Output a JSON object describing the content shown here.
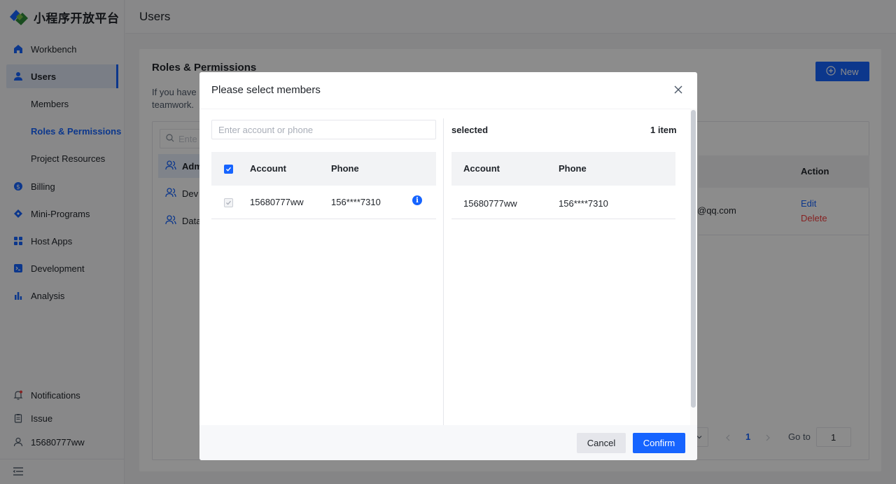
{
  "app": {
    "logo_text": "小程序开放平台",
    "page_title": "Users"
  },
  "sidebar": {
    "items": [
      {
        "label": "Workbench",
        "icon": "home-icon"
      },
      {
        "label": "Users",
        "icon": "user-icon"
      },
      {
        "label": "Billing",
        "icon": "coin-icon"
      },
      {
        "label": "Mini-Programs",
        "icon": "diamond-icon"
      },
      {
        "label": "Host Apps",
        "icon": "grid-icon"
      },
      {
        "label": "Development",
        "icon": "terminal-icon"
      },
      {
        "label": "Analysis",
        "icon": "bar-chart-icon"
      }
    ],
    "sub_items": [
      "Members",
      "Roles & Permissions",
      "Project Resources"
    ],
    "bottom": [
      {
        "label": "Notifications",
        "icon": "bell-icon"
      },
      {
        "label": "Issue",
        "icon": "clipboard-icon"
      },
      {
        "label": "15680777ww",
        "icon": "account-icon"
      }
    ]
  },
  "main": {
    "section_title": "Roles & Permissions",
    "desc_line1": "If you have",
    "desc_line2": "teamwork.",
    "new_button": "New",
    "role_search_placeholder": "Ente",
    "roles": [
      "Adm",
      "Dev",
      "Data"
    ],
    "action_header": "Action",
    "row_email": "@qq.com",
    "edit_link": "Edit",
    "delete_link": "Delete",
    "pagination": {
      "current_page": "1",
      "goto_label": "Go to",
      "goto_value": "1"
    }
  },
  "modal": {
    "title": "Please select members",
    "search_placeholder": "Enter account or phone",
    "left_table": {
      "headers": {
        "account": "Account",
        "phone": "Phone"
      },
      "rows": [
        {
          "account": "15680777ww",
          "phone": "156****7310"
        }
      ]
    },
    "selected_label": "selected",
    "selected_count": "1 item",
    "right_table": {
      "headers": {
        "account": "Account",
        "phone": "Phone"
      },
      "rows": [
        {
          "account": "15680777ww",
          "phone": "156****7310"
        }
      ]
    },
    "cancel_button": "Cancel",
    "confirm_button": "Confirm"
  },
  "colors": {
    "accent": "#1664ff",
    "danger": "#f53f3f",
    "overlay": "rgba(0,0,0,0.45)"
  }
}
